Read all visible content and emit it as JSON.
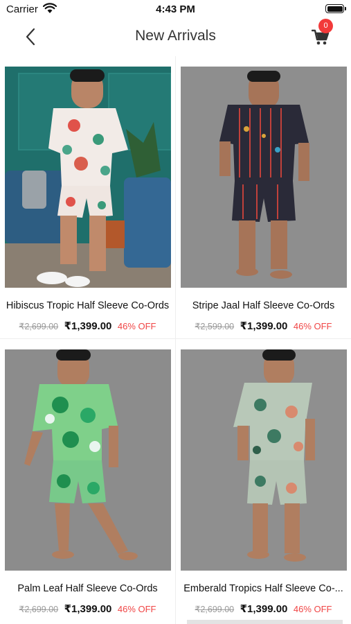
{
  "status_bar": {
    "carrier": "Carrier",
    "time": "4:43 PM"
  },
  "header": {
    "title": "New Arrivals",
    "cart_count": "0"
  },
  "colors": {
    "badge": "#f23a3a",
    "discount": "#f04545",
    "strike": "#9a9a9a"
  },
  "products": [
    {
      "name": "Hibiscus Tropic Half Sleeve Co-Ords",
      "mrp": "₹2,699.00",
      "price": "₹1,399.00",
      "discount": "46% OFF",
      "image": "man in white hibiscus print co-ord set on teal sofa"
    },
    {
      "name": "Stripe Jaal Half Sleeve Co-Ords",
      "mrp": "₹2,599.00",
      "price": "₹1,399.00",
      "discount": "46% OFF",
      "image": "man in dark striped jaal print co-ord set"
    },
    {
      "name": "Palm Leaf Half Sleeve Co-Ords",
      "mrp": "₹2,699.00",
      "price": "₹1,399.00",
      "discount": "46% OFF",
      "image": "man in green palm leaf print co-ord set"
    },
    {
      "name": "Emberald Tropics Half Sleeve Co-...",
      "mrp": "₹2,699.00",
      "price": "₹1,399.00",
      "discount": "46% OFF",
      "image": "man in sage tropical print co-ord set"
    }
  ]
}
